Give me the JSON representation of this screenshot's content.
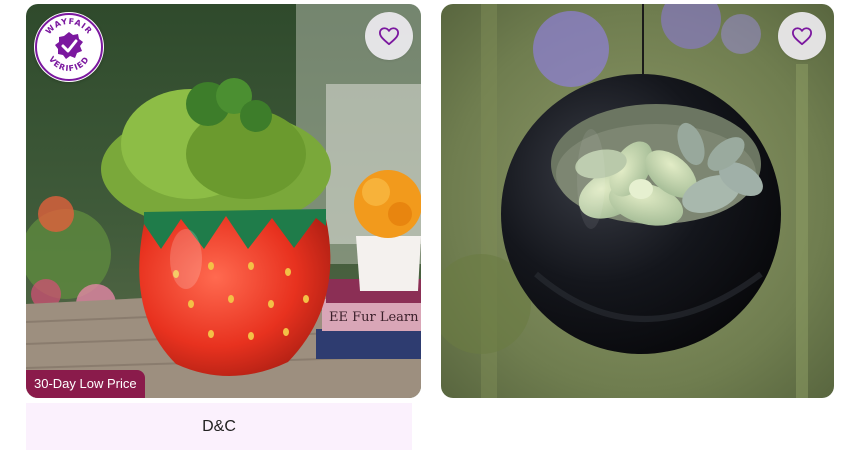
{
  "colors": {
    "accent_purple": "#7b189f",
    "price_badge": "#8a1b4b",
    "brand_bar_bg": "#fbf1fd",
    "heart_stroke": "#7b189f"
  },
  "products": [
    {
      "badge": {
        "text": "WAYFAIR VERIFIED",
        "icon": "checkmark-seal-icon"
      },
      "favorite_icon": "heart-outline-icon",
      "price_label": "30-Day Low Price",
      "brand": "D&C"
    },
    {
      "favorite_icon": "heart-outline-icon"
    }
  ]
}
